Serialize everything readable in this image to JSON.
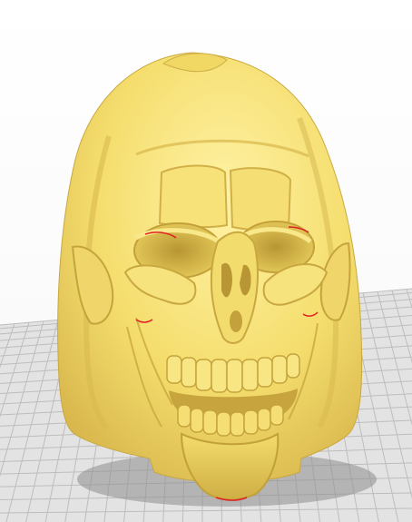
{
  "viewport": {
    "label": "",
    "model": {
      "name": "",
      "icon": "skull-model-icon",
      "body_color": "#f6e27a",
      "shadow_color": "#c9a93a",
      "highlight_color": "#fff4b0",
      "overhang_color": "#e02020"
    },
    "build_plate": {
      "icon": "build-plate-grid-icon",
      "plate_color": "#e3e3e3",
      "grid_color": "#bdbdbd"
    }
  }
}
